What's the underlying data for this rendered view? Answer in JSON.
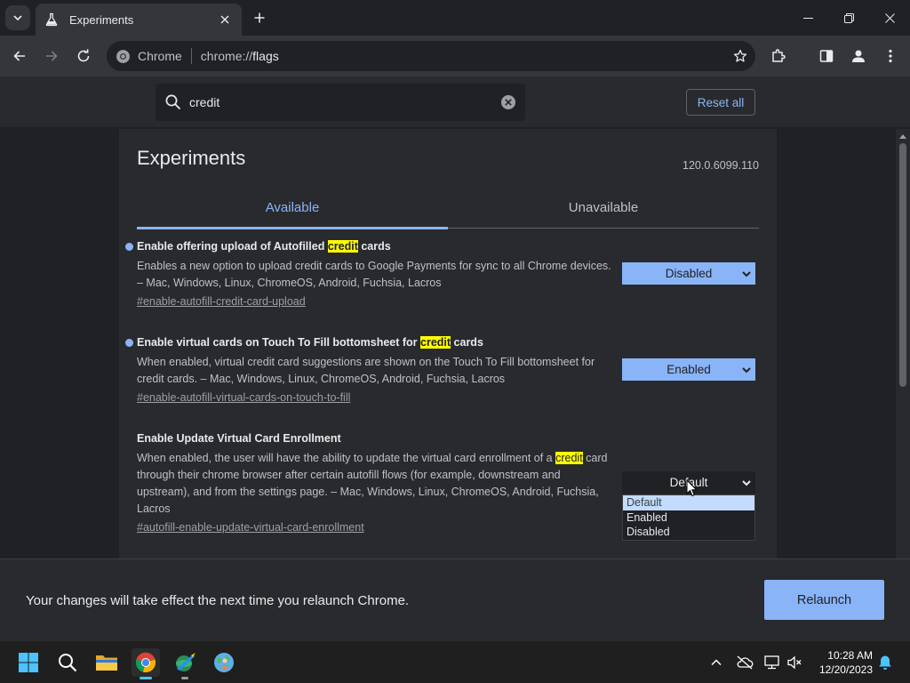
{
  "browser": {
    "tab_title": "Experiments",
    "site_name": "Chrome",
    "url_scheme": "chrome://",
    "url_path": "flags"
  },
  "flags_page": {
    "search_value": "credit",
    "reset_all_label": "Reset all",
    "heading": "Experiments",
    "version": "120.0.6099.110",
    "tabs": [
      {
        "label": "Available"
      },
      {
        "label": "Unavailable"
      }
    ],
    "flags": [
      {
        "title_before": "Enable offering upload of Autofilled ",
        "title_highlight": "credit",
        "title_after": " cards",
        "desc_before": "Enables a new option to upload credit cards to Google Payments for sync to all Chrome devices. – Mac, Windows, Linux, ChromeOS, Android, Fuchsia, Lacros",
        "desc_highlight": "",
        "desc_after": "",
        "link": "#enable-autofill-credit-card-upload",
        "value": "Disabled"
      },
      {
        "title_before": "Enable virtual cards on Touch To Fill bottomsheet for ",
        "title_highlight": "credit",
        "title_after": " cards",
        "desc_before": "When enabled, virtual credit card suggestions are shown on the Touch To Fill bottomsheet for credit cards. – Mac, Windows, Linux, ChromeOS, Android, Fuchsia, Lacros",
        "desc_highlight": "",
        "desc_after": "",
        "link": "#enable-autofill-virtual-cards-on-touch-to-fill",
        "value": "Enabled"
      },
      {
        "title_before": "Enable Update Virtual Card Enrollment",
        "title_highlight": "",
        "title_after": "",
        "desc_before": "When enabled, the user will have the ability to update the virtual card enrollment of a ",
        "desc_highlight": "credit",
        "desc_after": " card through their chrome browser after certain autofill flows (for example, downstream and upstream), and from the settings page. – Mac, Windows, Linux, ChromeOS, Android, Fuchsia, Lacros",
        "link": "#autofill-enable-update-virtual-card-enrollment",
        "value": "Default"
      }
    ],
    "dropdown_options": [
      "Default",
      "Enabled",
      "Disabled"
    ]
  },
  "relaunch": {
    "message": "Your changes will take effect the next time you relaunch Chrome.",
    "button_label": "Relaunch"
  },
  "taskbar": {
    "time": "10:28 AM",
    "date": "12/20/2023"
  },
  "colors": {
    "accent": "#8ab4f8",
    "highlight": "#ffff00",
    "background": "#202124",
    "surface": "#292a2d"
  },
  "icons": [
    "tab-search-icon",
    "flask-icon",
    "close-icon",
    "plus-icon",
    "minimize-icon",
    "restore-icon",
    "back-icon",
    "forward-icon",
    "reload-icon",
    "chrome-logo-icon",
    "star-icon",
    "extensions-icon",
    "side-panel-icon",
    "profile-icon",
    "more-icon",
    "search-icon",
    "clear-icon",
    "chevron-down-icon",
    "windows-start-icon",
    "file-explorer-icon",
    "chrome-icon"
  ]
}
